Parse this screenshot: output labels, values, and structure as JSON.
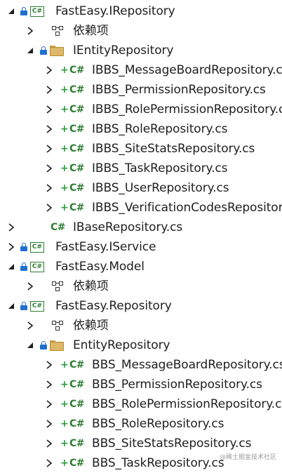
{
  "tree": [
    {
      "label": "FastEasy.IRepository",
      "type": "project",
      "expanded": true,
      "depth": 0
    },
    {
      "label": "依赖项",
      "type": "dependencies",
      "expanded": false,
      "depth": 1
    },
    {
      "label": "IEntityRepository",
      "type": "folder",
      "expanded": true,
      "depth": 1
    },
    {
      "label": "IBBS_MessageBoardRepository.cs",
      "type": "csfile",
      "expanded": false,
      "depth": 2
    },
    {
      "label": "IBBS_PermissionRepository.cs",
      "type": "csfile",
      "expanded": false,
      "depth": 2
    },
    {
      "label": "IBBS_RolePermissionRepository.cs",
      "type": "csfile",
      "expanded": false,
      "depth": 2
    },
    {
      "label": "IBBS_RoleRepository.cs",
      "type": "csfile",
      "expanded": false,
      "depth": 2
    },
    {
      "label": "IBBS_SiteStatsRepository.cs",
      "type": "csfile",
      "expanded": false,
      "depth": 2
    },
    {
      "label": "IBBS_TaskRepository.cs",
      "type": "csfile",
      "expanded": false,
      "depth": 2
    },
    {
      "label": "IBBS_UserRepository.cs",
      "type": "csfile",
      "expanded": false,
      "depth": 2
    },
    {
      "label": "IBBS_VerificationCodesRepository.cs",
      "type": "csfile",
      "expanded": false,
      "depth": 2
    },
    {
      "label": "IBaseRepository.cs",
      "type": "csfile",
      "expanded": false,
      "depth": 1
    },
    {
      "label": "FastEasy.IService",
      "type": "project",
      "expanded": false,
      "depth": 0
    },
    {
      "label": "FastEasy.Model",
      "type": "project",
      "expanded": true,
      "depth": 0
    },
    {
      "label": "依赖项",
      "type": "dependencies",
      "expanded": false,
      "depth": 1
    },
    {
      "label": "FastEasy.Repository",
      "type": "project",
      "expanded": true,
      "depth": 0
    },
    {
      "label": "依赖项",
      "type": "dependencies",
      "expanded": false,
      "depth": 1
    },
    {
      "label": "EntityRepository",
      "type": "folder",
      "expanded": true,
      "depth": 1
    },
    {
      "label": "BBS_MessageBoardRepository.cs",
      "type": "csfile",
      "expanded": false,
      "depth": 2
    },
    {
      "label": "BBS_PermissionRepository.cs",
      "type": "csfile",
      "expanded": false,
      "depth": 2
    },
    {
      "label": "BBS_RolePermissionRepository.cs",
      "type": "csfile",
      "expanded": false,
      "depth": 2
    },
    {
      "label": "BBS_RoleRepository.cs",
      "type": "csfile",
      "expanded": false,
      "depth": 2
    },
    {
      "label": "BBS_SiteStatsRepository.cs",
      "type": "csfile",
      "expanded": false,
      "depth": 2
    },
    {
      "label": "BBS_TaskRepository.cs",
      "type": "csfile",
      "expanded": false,
      "depth": 2
    }
  ],
  "icons": {
    "csharp_badge": "C#",
    "csfile_badge": "C#",
    "add_mark": "+"
  },
  "colors": {
    "csharp_green": "#2e7d32",
    "lock_blue": "#1f6fd1",
    "folder_yellow": "#dcb869"
  },
  "watermark": "@稀土掘金技术社区"
}
